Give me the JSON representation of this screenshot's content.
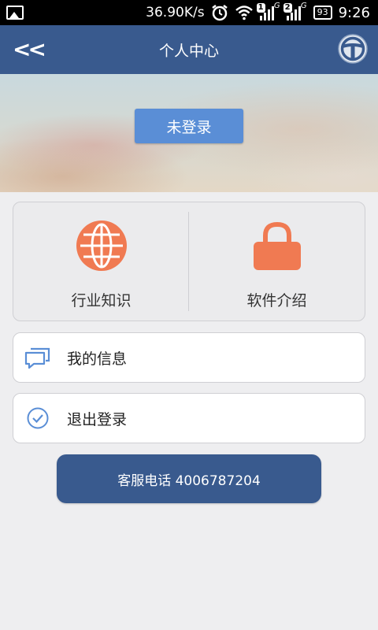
{
  "status_bar": {
    "speed": "36.90K/s",
    "sim1": "1",
    "sim2": "2",
    "network_gen": "G",
    "battery": "93",
    "time": "9:26"
  },
  "header": {
    "back_label": "<<",
    "title": "个人中心"
  },
  "banner": {
    "login_label": "未登录"
  },
  "grid": {
    "items": [
      {
        "label": "行业知识",
        "icon": "globe-icon",
        "color": "#f07a52"
      },
      {
        "label": "软件介绍",
        "icon": "lock-icon",
        "color": "#f07a52"
      }
    ]
  },
  "menu": {
    "items": [
      {
        "label": "我的信息",
        "icon": "message-icon"
      },
      {
        "label": "退出登录",
        "icon": "check-circle-icon"
      }
    ]
  },
  "footer": {
    "phone_label": "客服电话  4006787204"
  },
  "colors": {
    "brand": "#395a8e",
    "login_button": "#5a8ed6",
    "accent": "#f07a52",
    "icon_blue": "#5a8ed6"
  }
}
